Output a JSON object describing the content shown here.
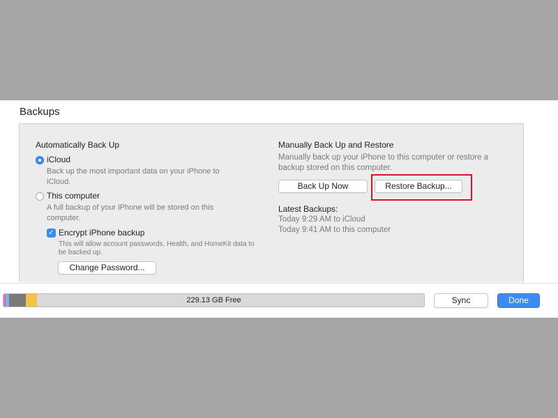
{
  "section_title": "Backups",
  "auto": {
    "heading": "Automatically Back Up",
    "icloud_label": "iCloud",
    "icloud_desc_1": "Back up the most important data on your iPhone to",
    "icloud_desc_2": "iCloud.",
    "computer_label": "This computer",
    "computer_desc_1": "A full backup of your iPhone will be stored on this",
    "computer_desc_2": "computer.",
    "encrypt_label": "Encrypt iPhone backup",
    "encrypt_desc_1": "This will allow account passwords, Health, and HomeKit data to",
    "encrypt_desc_2": "be backed up.",
    "change_password": "Change Password...",
    "selected": "iCloud",
    "encrypt_checked": true
  },
  "manual": {
    "heading": "Manually Back Up and Restore",
    "desc_1": "Manually back up your iPhone to this computer or restore a",
    "desc_2": "backup stored on this computer.",
    "back_up_now": "Back Up Now",
    "restore_backup": "Restore Backup...",
    "latest_heading": "Latest Backups:",
    "latest_1": "Today 9:29 AM to iCloud",
    "latest_2": "Today 9:41 AM to this computer"
  },
  "footer": {
    "storage_text": "229.13 GB Free",
    "sync": "Sync",
    "done": "Done"
  },
  "colors": {
    "accent": "#3b8cf0",
    "highlight": "#d9132f",
    "storage_apps": "#f5c242",
    "storage_photos": "#d86fd1",
    "storage_other": "#7a7a7a"
  }
}
